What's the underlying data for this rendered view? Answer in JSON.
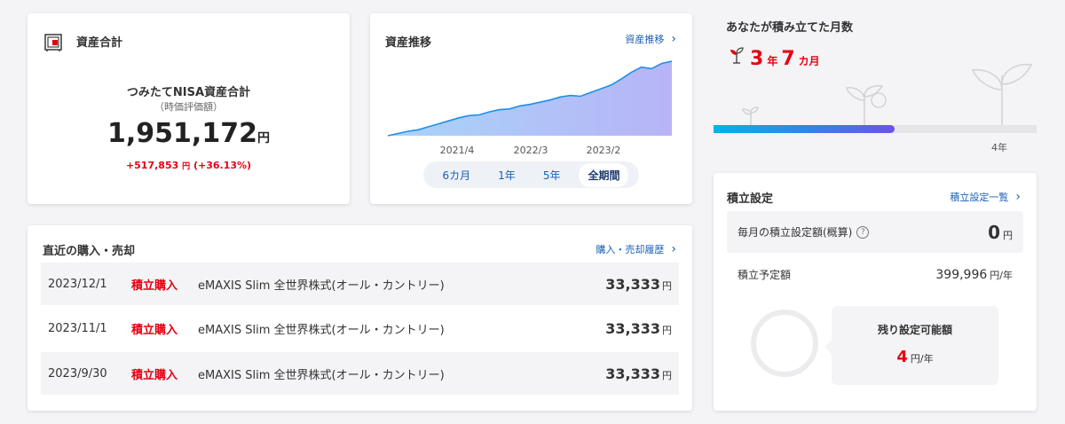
{
  "asset_total": {
    "title": "資産合計",
    "nisa_label": "つみたてNISA資産合計",
    "nisa_sub": "（時価評価額）",
    "amount": "1,951,172",
    "amount_unit": "円",
    "gain": "+517,853",
    "gain_unit": "円",
    "gain_pct": "(+36.13%)"
  },
  "trend": {
    "title": "資産推移",
    "link": "資産推移",
    "chart_data": {
      "type": "area",
      "x_tick_labels": [
        "2021/4",
        "2022/3",
        "2023/2"
      ],
      "values": [
        0.0,
        0.03,
        0.06,
        0.08,
        0.12,
        0.16,
        0.2,
        0.24,
        0.27,
        0.28,
        0.32,
        0.35,
        0.36,
        0.4,
        0.42,
        0.45,
        0.48,
        0.52,
        0.54,
        0.53,
        0.58,
        0.63,
        0.68,
        0.76,
        0.85,
        0.92,
        0.9,
        0.97,
        1.0
      ],
      "fill_top": "#8fb9f5",
      "fill_right": "#b9b6f7",
      "line_color": "#1e8fe8"
    },
    "periods": [
      {
        "label": "6カ月",
        "active": false
      },
      {
        "label": "1年",
        "active": false
      },
      {
        "label": "5年",
        "active": false
      },
      {
        "label": "全期間",
        "active": true
      }
    ]
  },
  "months": {
    "title": "あなたが積み立てた月数",
    "years": "3",
    "years_unit": "年",
    "months": "7",
    "months_unit": "カ月",
    "progress_fraction": 0.56,
    "progress_end_label": "4年"
  },
  "recent": {
    "title": "直近の購入・売却",
    "link": "購入・売却履歴",
    "rows": [
      {
        "date": "2023/12/1",
        "type": "積立購入",
        "fund": "eMAXIS Slim 全世界株式(オール・カントリー)",
        "amount": "33,333",
        "unit": "円"
      },
      {
        "date": "2023/11/1",
        "type": "積立購入",
        "fund": "eMAXIS Slim 全世界株式(オール・カントリー)",
        "amount": "33,333",
        "unit": "円"
      },
      {
        "date": "2023/9/30",
        "type": "積立購入",
        "fund": "eMAXIS Slim 全世界株式(オール・カントリー)",
        "amount": "33,333",
        "unit": "円"
      }
    ]
  },
  "plan": {
    "title": "積立設定",
    "link": "積立設定一覧",
    "monthly_label": "毎月の積立設定額(概算)",
    "monthly_value": "0",
    "monthly_unit": "円",
    "planned_label": "積立予定額",
    "planned_value": "399,996",
    "planned_unit": "円/年",
    "remain_label": "残り設定可能額",
    "remain_value": "4",
    "remain_unit": "円/年"
  }
}
